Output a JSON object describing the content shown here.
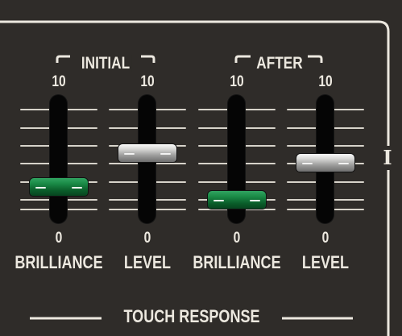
{
  "panel": {
    "colors": {
      "background": "#2f2c29",
      "text": "#ece8df",
      "accent_green": "#1a8a46",
      "silver": "#c9c9c7"
    },
    "group_titles": {
      "initial": "INITIAL",
      "after": "AFTER"
    },
    "section_marker": "I",
    "footer_title": "TOUCH RESPONSE",
    "sliders": [
      {
        "id": "initial-brilliance",
        "top_label": "10",
        "bottom_label": "0",
        "label": "BRILLIANCE",
        "value_fraction": 0.19,
        "knob_color": "green"
      },
      {
        "id": "initial-level",
        "top_label": "10",
        "bottom_label": "0",
        "label": "LEVEL",
        "value_fraction": 0.55,
        "knob_color": "silver"
      },
      {
        "id": "after-brilliance",
        "top_label": "10",
        "bottom_label": "0",
        "label": "BRILLIANCE",
        "value_fraction": 0.05,
        "knob_color": "green"
      },
      {
        "id": "after-level",
        "top_label": "10",
        "bottom_label": "0",
        "label": "LEVEL",
        "value_fraction": 0.45,
        "knob_color": "silver"
      }
    ]
  }
}
